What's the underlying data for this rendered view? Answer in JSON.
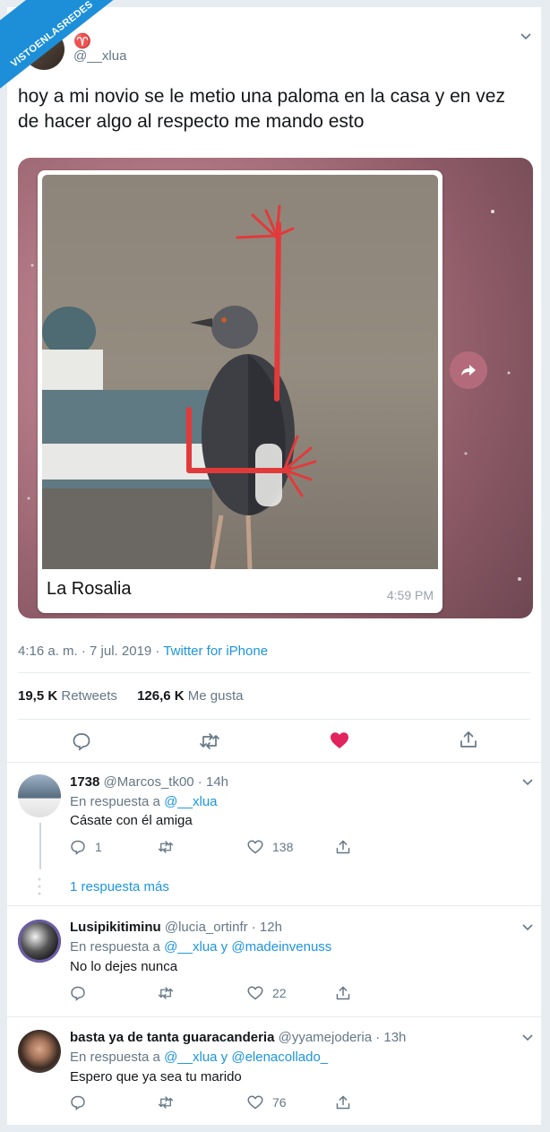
{
  "watermark": "VISTOENLASREDES",
  "tweet": {
    "display_name": "♈",
    "handle": "@__xlua",
    "text_line1": "hoy a mi novio se le metio una paloma en la casa y en vez",
    "text_line2": "de hacer algo al respecto me mando esto",
    "image": {
      "caption": "La Rosalia",
      "time": "4:59 PM"
    },
    "timestamp": "4:16 a. m. · 7 jul. 2019 · ",
    "source": "Twitter for iPhone",
    "retweets_count": "19,5 K",
    "retweets_label": "Retweets",
    "likes_count": "126,6 K",
    "likes_label": "Me gusta",
    "colors": {
      "accent": "#1b95e0",
      "like": "#e0245e"
    }
  },
  "replies": [
    {
      "name": "1738",
      "handle": "@Marcos_tk00 · 14h",
      "reply_prefix": "En respuesta a ",
      "reply_to": "@__xlua",
      "text": "Cásate con él amiga",
      "comments": "1",
      "retweets": "",
      "likes": "138",
      "more": "1 respuesta más"
    },
    {
      "name": "Lusipikitiminu",
      "handle": "@lucia_ortinfr · 12h",
      "reply_prefix": "En respuesta a ",
      "reply_to": "@__xlua y @madeinvenuss",
      "text": "No lo dejes nunca",
      "comments": "",
      "retweets": "",
      "likes": "22"
    },
    {
      "name": "basta ya de tanta guaracanderia",
      "handle": "@yyamejoderia · 13h",
      "reply_prefix": "En respuesta a ",
      "reply_to": "@__xlua y @elenacollado_",
      "text": "Espero que ya sea tu marido",
      "comments": "",
      "retweets": "",
      "likes": "76"
    }
  ]
}
